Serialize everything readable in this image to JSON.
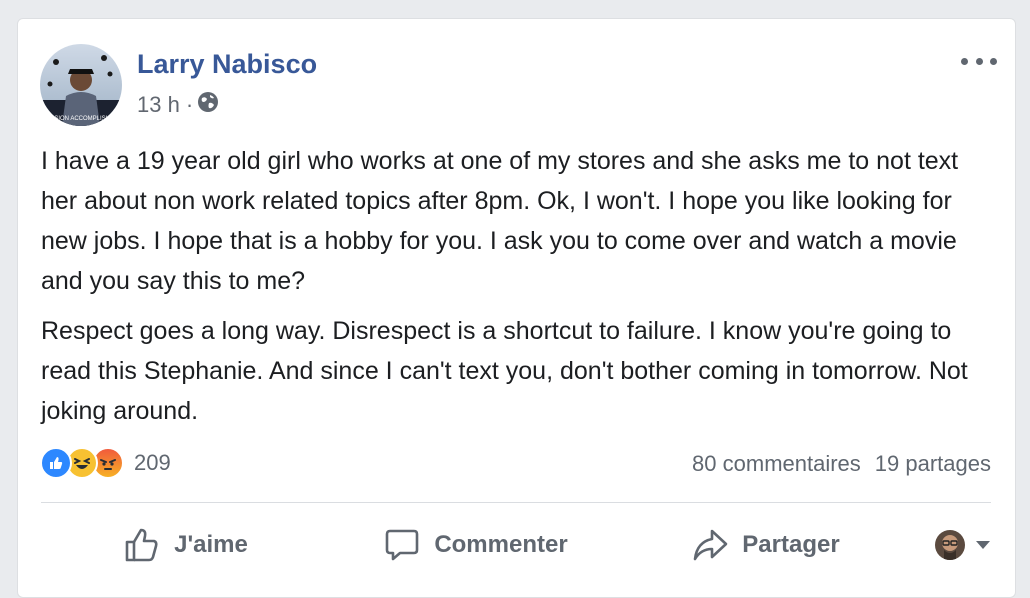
{
  "post": {
    "author": "Larry Nabisco",
    "time": "13 h",
    "separator": "·",
    "privacy_icon": "globe-icon",
    "avatar_text": "MISSION ACCOMPLISHED",
    "paragraphs": [
      "I have a 19 year old girl who works at one of my stores and she asks me to not text her about non work related topics after 8pm. Ok, I won't. I hope you like looking for new jobs. I hope that is a hobby for you. I ask you to come over and watch a movie and you say this to me?",
      "Respect goes a long way. Disrespect is a shortcut to failure. I know you're going to read this Stephanie. And since I can't text you, don't bother coming in tomorrow. Not joking around."
    ],
    "reactions": {
      "icons": [
        "like-reaction-icon",
        "haha-reaction-icon",
        "angry-reaction-icon"
      ],
      "count": "209"
    },
    "comments_label": "80 commentaires",
    "shares_label": "19 partages"
  },
  "actions": {
    "like_label": "J'aime",
    "comment_label": "Commenter",
    "share_label": "Partager"
  },
  "colors": {
    "author": "#385898",
    "text": "#1c1e21",
    "secondary": "#606770",
    "like_blue": "#2d88ff"
  }
}
